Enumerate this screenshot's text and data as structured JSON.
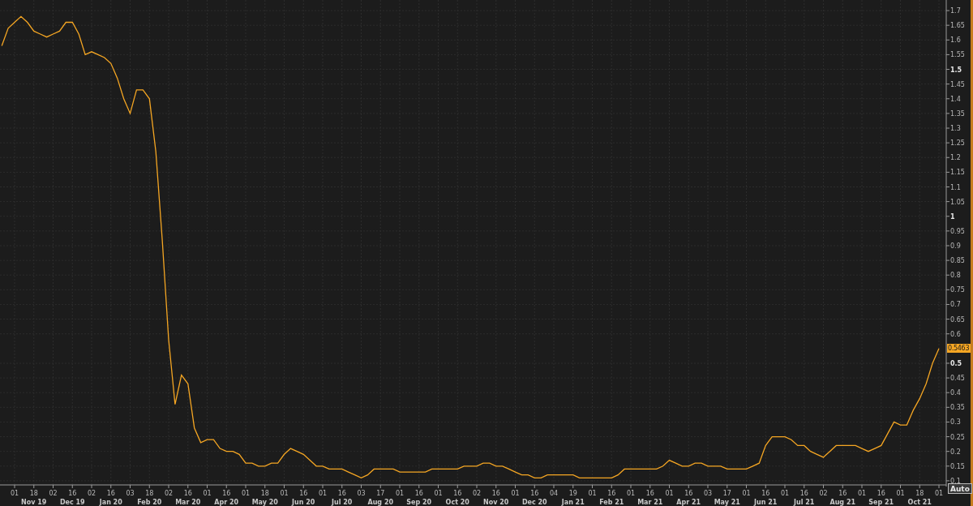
{
  "chart": {
    "last_price": "0.5463",
    "auto_button": "Auto",
    "chart_data": {
      "type": "line",
      "grid": true,
      "ylim": [
        0.086,
        1.736
      ],
      "yticks": [
        0.1,
        0.15,
        0.2,
        0.25,
        0.3,
        0.35,
        0.4,
        0.45,
        0.5,
        0.6,
        0.65,
        0.7,
        0.75,
        0.8,
        0.85,
        0.9,
        0.95,
        1,
        1.05,
        1.1,
        1.15,
        1.2,
        1.25,
        1.3,
        1.35,
        1.4,
        1.45,
        1.5,
        1.55,
        1.6,
        1.65,
        1.7
      ],
      "categories": [
        null,
        null,
        "01",
        null,
        null,
        "18",
        null,
        null,
        "02",
        null,
        null,
        "16",
        null,
        null,
        "02",
        null,
        null,
        "16",
        null,
        null,
        "03",
        null,
        null,
        "18",
        null,
        null,
        "02",
        null,
        null,
        "16",
        null,
        null,
        "01",
        null,
        null,
        "16",
        null,
        null,
        "01",
        null,
        null,
        "18",
        null,
        null,
        "01",
        null,
        null,
        "16",
        null,
        null,
        "01",
        null,
        null,
        "16",
        null,
        null,
        "03",
        null,
        null,
        "17",
        null,
        null,
        "01",
        null,
        null,
        "16",
        null,
        null,
        "01",
        null,
        null,
        "16",
        null,
        null,
        "02",
        null,
        null,
        "16",
        null,
        null,
        "01",
        null,
        null,
        "16",
        null,
        null,
        "04",
        null,
        null,
        "19",
        null,
        null,
        "01",
        null,
        null,
        "16",
        null,
        null,
        "01",
        null,
        null,
        "16",
        null,
        null,
        "01",
        null,
        null,
        "16",
        null,
        null,
        "03",
        null,
        null,
        "17",
        null,
        null,
        "01",
        null,
        null,
        "16",
        null,
        null,
        "01",
        null,
        null,
        "16",
        null,
        null,
        "02",
        null,
        null,
        "16",
        null,
        null,
        "01",
        null,
        null,
        "16",
        null,
        null,
        "01",
        null,
        null,
        "18",
        null,
        null,
        "01"
      ],
      "series": [
        {
          "color": "#f5a623",
          "values": [
            1.58,
            1.64,
            1.66,
            1.68,
            1.66,
            1.63,
            1.62,
            1.61,
            1.62,
            1.63,
            1.66,
            1.66,
            1.62,
            1.55,
            1.56,
            1.55,
            1.54,
            1.52,
            1.47,
            1.4,
            1.35,
            1.43,
            1.43,
            1.4,
            1.22,
            0.92,
            0.58,
            0.36,
            0.46,
            0.43,
            0.28,
            0.23,
            0.24,
            0.24,
            0.21,
            0.2,
            0.2,
            0.19,
            0.16,
            0.16,
            0.15,
            0.15,
            0.16,
            0.16,
            0.19,
            0.21,
            0.2,
            0.19,
            0.17,
            0.15,
            0.15,
            0.14,
            0.14,
            0.14,
            0.13,
            0.12,
            0.11,
            0.12,
            0.14,
            0.14,
            0.14,
            0.14,
            0.13,
            0.13,
            0.13,
            0.13,
            0.13,
            0.14,
            0.14,
            0.14,
            0.14,
            0.14,
            0.15,
            0.15,
            0.15,
            0.16,
            0.16,
            0.15,
            0.15,
            0.14,
            0.13,
            0.12,
            0.12,
            0.11,
            0.11,
            0.12,
            0.12,
            0.12,
            0.12,
            0.12,
            0.11,
            0.11,
            0.11,
            0.11,
            0.11,
            0.11,
            0.12,
            0.14,
            0.14,
            0.14,
            0.14,
            0.14,
            0.14,
            0.15,
            0.17,
            0.16,
            0.15,
            0.15,
            0.16,
            0.16,
            0.15,
            0.15,
            0.15,
            0.14,
            0.14,
            0.14,
            0.14,
            0.15,
            0.16,
            0.22,
            0.25,
            0.25,
            0.25,
            0.24,
            0.22,
            0.22,
            0.2,
            0.19,
            0.18,
            0.2,
            0.22,
            0.22,
            0.22,
            0.22,
            0.21,
            0.2,
            0.21,
            0.22,
            0.26,
            0.3,
            0.29,
            0.29,
            0.34,
            0.38,
            0.43,
            0.5,
            0.55
          ]
        }
      ]
    },
    "month_labels": [
      "Nov 19",
      "Dec 19",
      "Jan 20",
      "Feb 20",
      "Mar 20",
      "Apr 20",
      "May 20",
      "Jun 20",
      "Jul 20",
      "Aug 20",
      "Sep 20",
      "Oct 20",
      "Nov 20",
      "Dec 20",
      "Jan 21",
      "Feb 21",
      "Mar 21",
      "Apr 21",
      "May 21",
      "Jun 21",
      "Jul 21",
      "Aug 21",
      "Sep 21",
      "Oct 21"
    ]
  }
}
